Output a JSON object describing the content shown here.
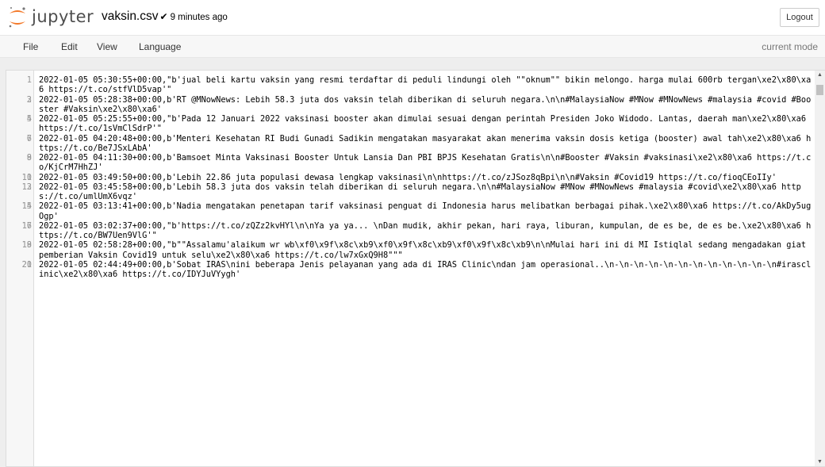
{
  "header": {
    "logo_text": "jupyter",
    "filename": "vaksin.csv",
    "saved_mark": "✔",
    "last_modified": "9 minutes ago",
    "logout_label": "Logout"
  },
  "colors": {
    "logo_orange": "#f37726",
    "logo_gray": "#767677"
  },
  "menu": {
    "items": [
      {
        "label": "File"
      },
      {
        "label": "Edit"
      },
      {
        "label": "View"
      },
      {
        "label": "Language"
      }
    ],
    "mode": "current mode"
  },
  "editor": {
    "lines": [
      {
        "num": "1",
        "text": "2022-01-05 05:30:55+00:00,\"b'jual beli kartu vaksin yang resmi terdaftar di peduli lindungi oleh \"\"oknum\"\" bikin melongo. harga mulai 600rb tergan\\xe2\\x80\\xa6 https://t.co/stfVlD5vap'\""
      },
      {
        "num": "2",
        "text": ""
      },
      {
        "num": "3",
        "text": "2022-01-05 05:28:38+00:00,b'RT @MNowNews: Lebih 58.3 juta dos vaksin telah diberikan di seluruh negara.\\n\\n#MalaysiaNow #MNow #MNowNews #malaysia #covid #Booster #Vaksin\\xe2\\x80\\xa6'"
      },
      {
        "num": "4",
        "text": ""
      },
      {
        "num": "5",
        "text": "2022-01-05 05:25:55+00:00,\"b'Pada 12 Januari 2022 vaksinasi booster akan dimulai sesuai dengan perintah Presiden Joko Widodo. Lantas, daerah man\\xe2\\x80\\xa6 https://t.co/1sVmClSdrP'\""
      },
      {
        "num": "6",
        "text": ""
      },
      {
        "num": "7",
        "text": "2022-01-05 04:20:48+00:00,b'Menteri Kesehatan RI Budi Gunadi Sadikin mengatakan masyarakat akan menerima vaksin dosis ketiga (booster) awal tah\\xe2\\x80\\xa6 https://t.co/Be7JSxLAbA'"
      },
      {
        "num": "8",
        "text": ""
      },
      {
        "num": "9",
        "text": "2022-01-05 04:11:30+00:00,b'Bamsoet Minta Vaksinasi Booster Untuk Lansia Dan PBI BPJS Kesehatan Gratis\\n\\n#Booster #Vaksin #vaksinasi\\xe2\\x80\\xa6 https://t.co/KjCrM7HhZJ'"
      },
      {
        "num": "10",
        "text": ""
      },
      {
        "num": "11",
        "text": "2022-01-05 03:49:50+00:00,b'Lebih 22.86 juta populasi dewasa lengkap vaksinasi\\n\\nhttps://t.co/zJSoz8qBpi\\n\\n#Vaksin #Covid19 https://t.co/fioqCEoIIy'"
      },
      {
        "num": "12",
        "text": ""
      },
      {
        "num": "13",
        "text": "2022-01-05 03:45:58+00:00,b'Lebih 58.3 juta dos vaksin telah diberikan di seluruh negara.\\n\\n#MalaysiaNow #MNow #MNowNews #malaysia #covid\\xe2\\x80\\xa6 https://t.co/umlUmX6vqz'"
      },
      {
        "num": "14",
        "text": ""
      },
      {
        "num": "15",
        "text": "2022-01-05 03:13:41+00:00,b'Nadia mengatakan penetapan tarif vaksinasi penguat di Indonesia harus melibatkan berbagai pihak.\\xe2\\x80\\xa6 https://t.co/AkDy5ugOgp'"
      },
      {
        "num": "16",
        "text": ""
      },
      {
        "num": "17",
        "text": "2022-01-05 03:02:37+00:00,\"b'https://t.co/zQZz2kvHYl\\n\\nYa ya ya... \\nDan mudik, akhir pekan, hari raya, liburan, kumpulan, de es be, de es be.\\xe2\\x80\\xa6 https://t.co/BW7Uen9VlG'\""
      },
      {
        "num": "18",
        "text": ""
      },
      {
        "num": "19",
        "text": "2022-01-05 02:58:28+00:00,\"b\"\"Assalamu'alaikum wr wb\\xf0\\x9f\\x8c\\xb9\\xf0\\x9f\\x8c\\xb9\\xf0\\x9f\\x8c\\xb9\\n\\nMulai hari ini di MI Istiqlal sedang mengadakan giat pemberian Vaksin Covid19 untuk selu\\xe2\\x80\\xa6 https://t.co/lw7xGxQ9H8\"\"\""
      },
      {
        "num": "20",
        "text": ""
      },
      {
        "num": "21",
        "text": "2022-01-05 02:44:49+00:00,b'Sobat IRAS\\nini beberapa Jenis pelayanan yang ada di IRAS Clinic\\ndan jam operasional..\\n-\\n-\\n-\\n-\\n-\\n-\\n-\\n-\\n-\\n-\\n-\\n#irasclinic\\xe2\\x80\\xa6 https://t.co/IDYJuVYygh'"
      }
    ]
  }
}
